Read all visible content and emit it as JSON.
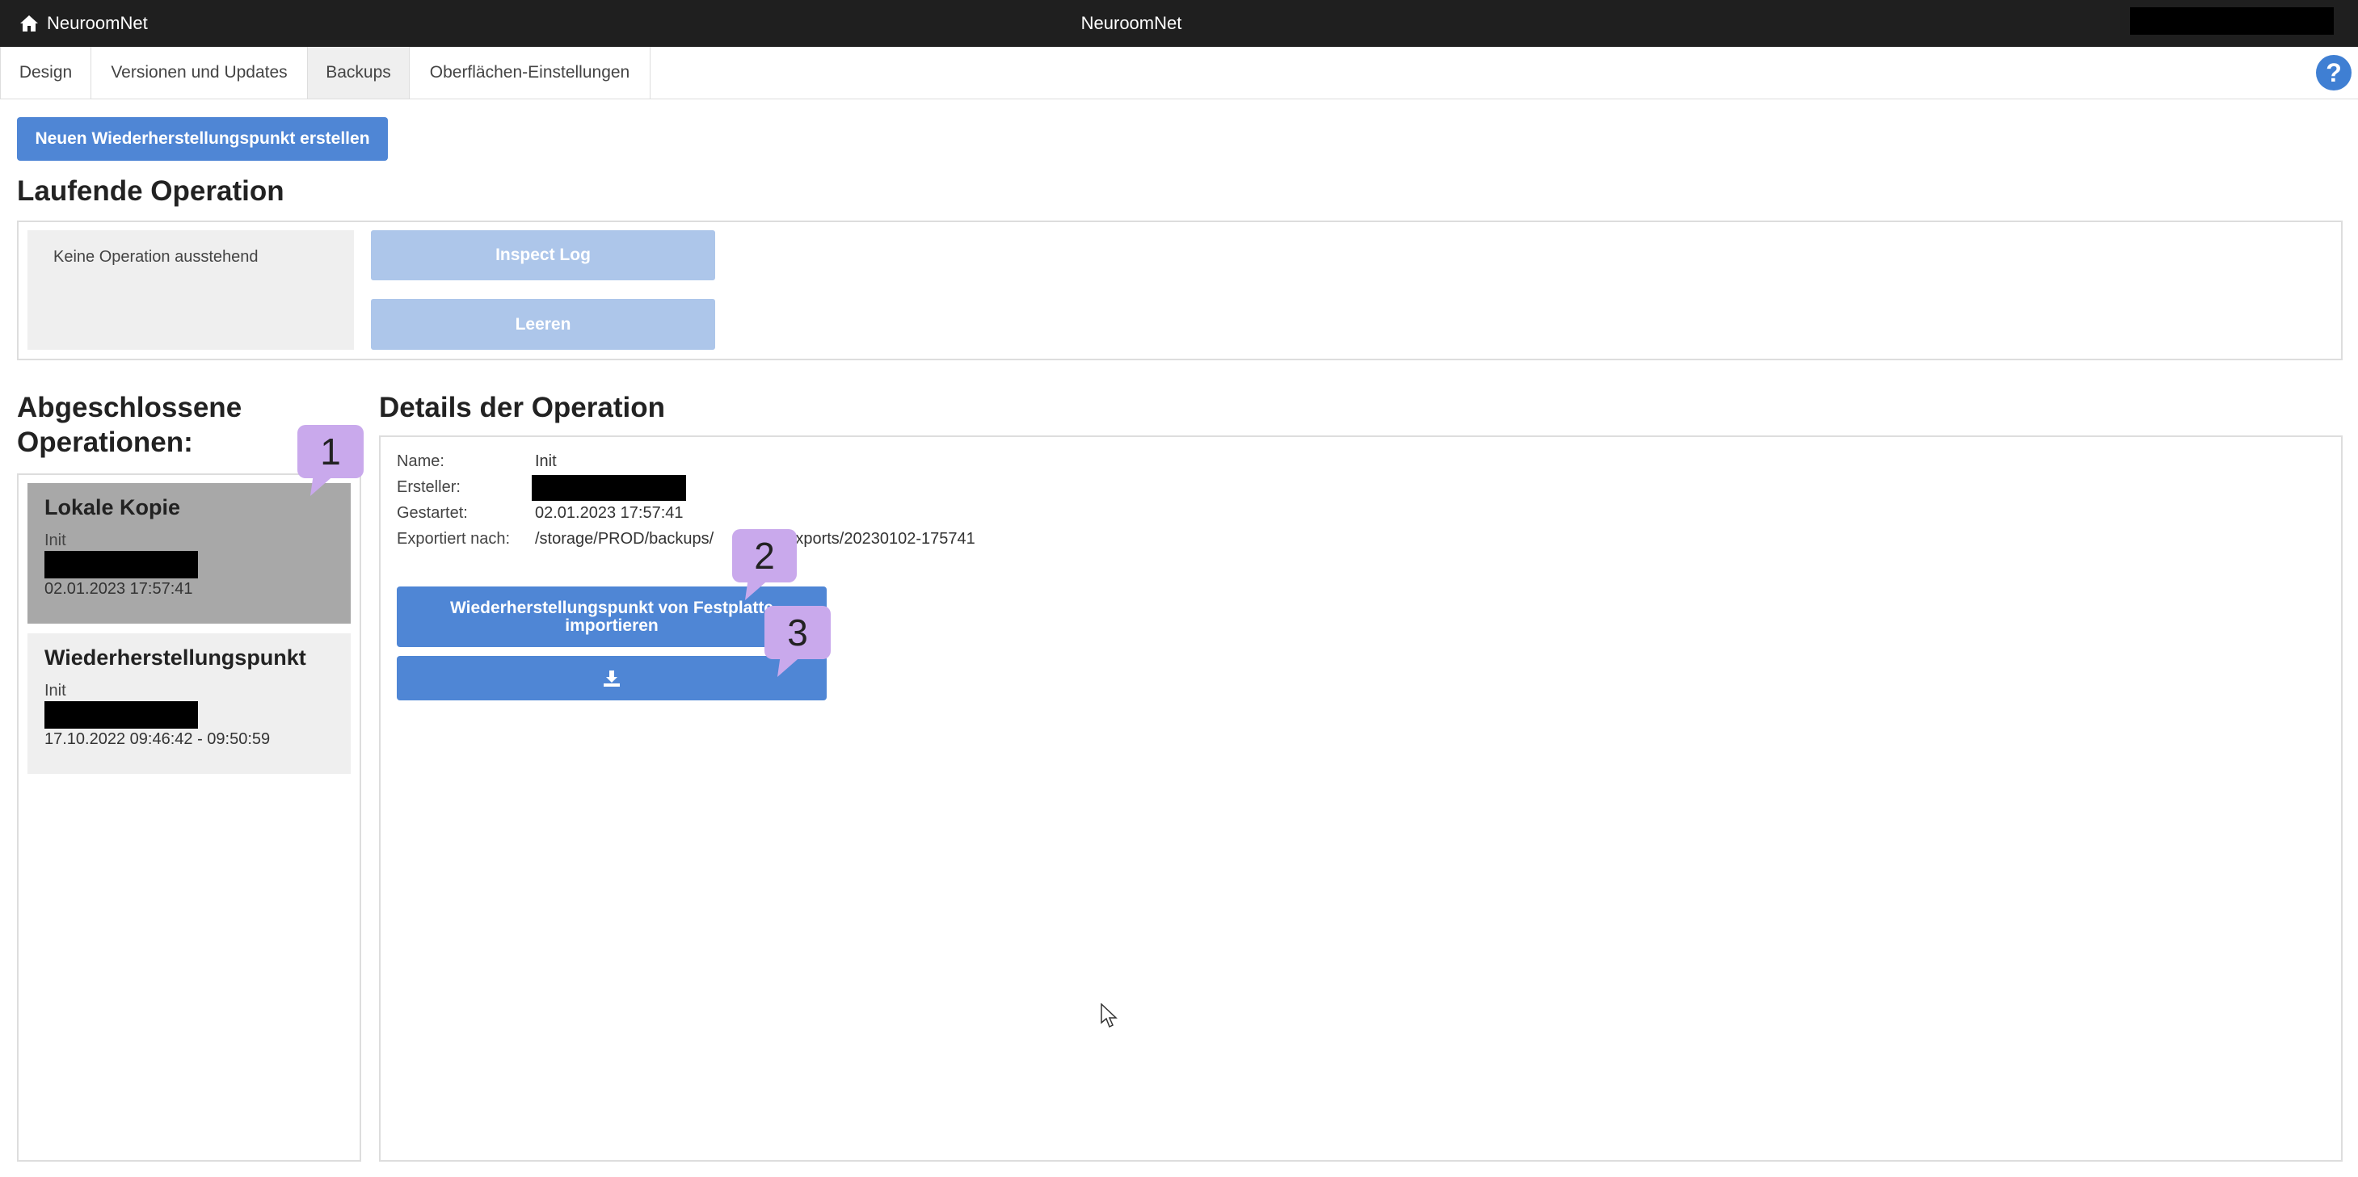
{
  "app": {
    "brand": "NeuroomNet",
    "center_title": "NeuroomNet"
  },
  "tabs": [
    {
      "label": "Design",
      "active": false
    },
    {
      "label": "Versionen und Updates",
      "active": false
    },
    {
      "label": "Backups",
      "active": true
    },
    {
      "label": "Oberflächen-Einstellungen",
      "active": false
    }
  ],
  "help": {
    "symbol": "?"
  },
  "actions": {
    "create_restore_point": "Neuen Wiederherstellungspunkt erstellen"
  },
  "running": {
    "heading": "Laufende Operation",
    "status": "Keine Operation ausstehend",
    "inspect_log": "Inspect Log",
    "clear": "Leeren"
  },
  "completed": {
    "heading_line1": "Abgeschlossene",
    "heading_line2": "Operationen:",
    "items": [
      {
        "title": "Lokale Kopie",
        "name": "Init",
        "date": "02.01.2023 17:57:41",
        "selected": true
      },
      {
        "title": "Wiederherstellungspunkt",
        "name": "Init",
        "date": "17.10.2022 09:46:42 - 09:50:59",
        "selected": false
      }
    ]
  },
  "details": {
    "heading": "Details der Operation",
    "labels": {
      "name": "Name:",
      "creator": "Ersteller:",
      "started": "Gestartet:",
      "exported_to": "Exportiert nach:"
    },
    "values": {
      "name": "Init",
      "started": "02.01.2023 17:57:41",
      "exported_to_prefix": "/storage/PROD/backups/",
      "exported_to_suffix": "exports/20230102-175741"
    },
    "import_button_line1": "Wiederherstellungspunkt von Festplatte",
    "import_button_line2": "importieren",
    "download_icon": "download-icon"
  },
  "annotations": [
    "1",
    "2",
    "3"
  ],
  "colors": {
    "topbar": "#1f1f1f",
    "primary": "#4f86d5",
    "primary_disabled": "#adc6ea",
    "selected_item": "#a8a8a8",
    "bubble": "#c9a9ec",
    "help": "#3f7fd3"
  }
}
